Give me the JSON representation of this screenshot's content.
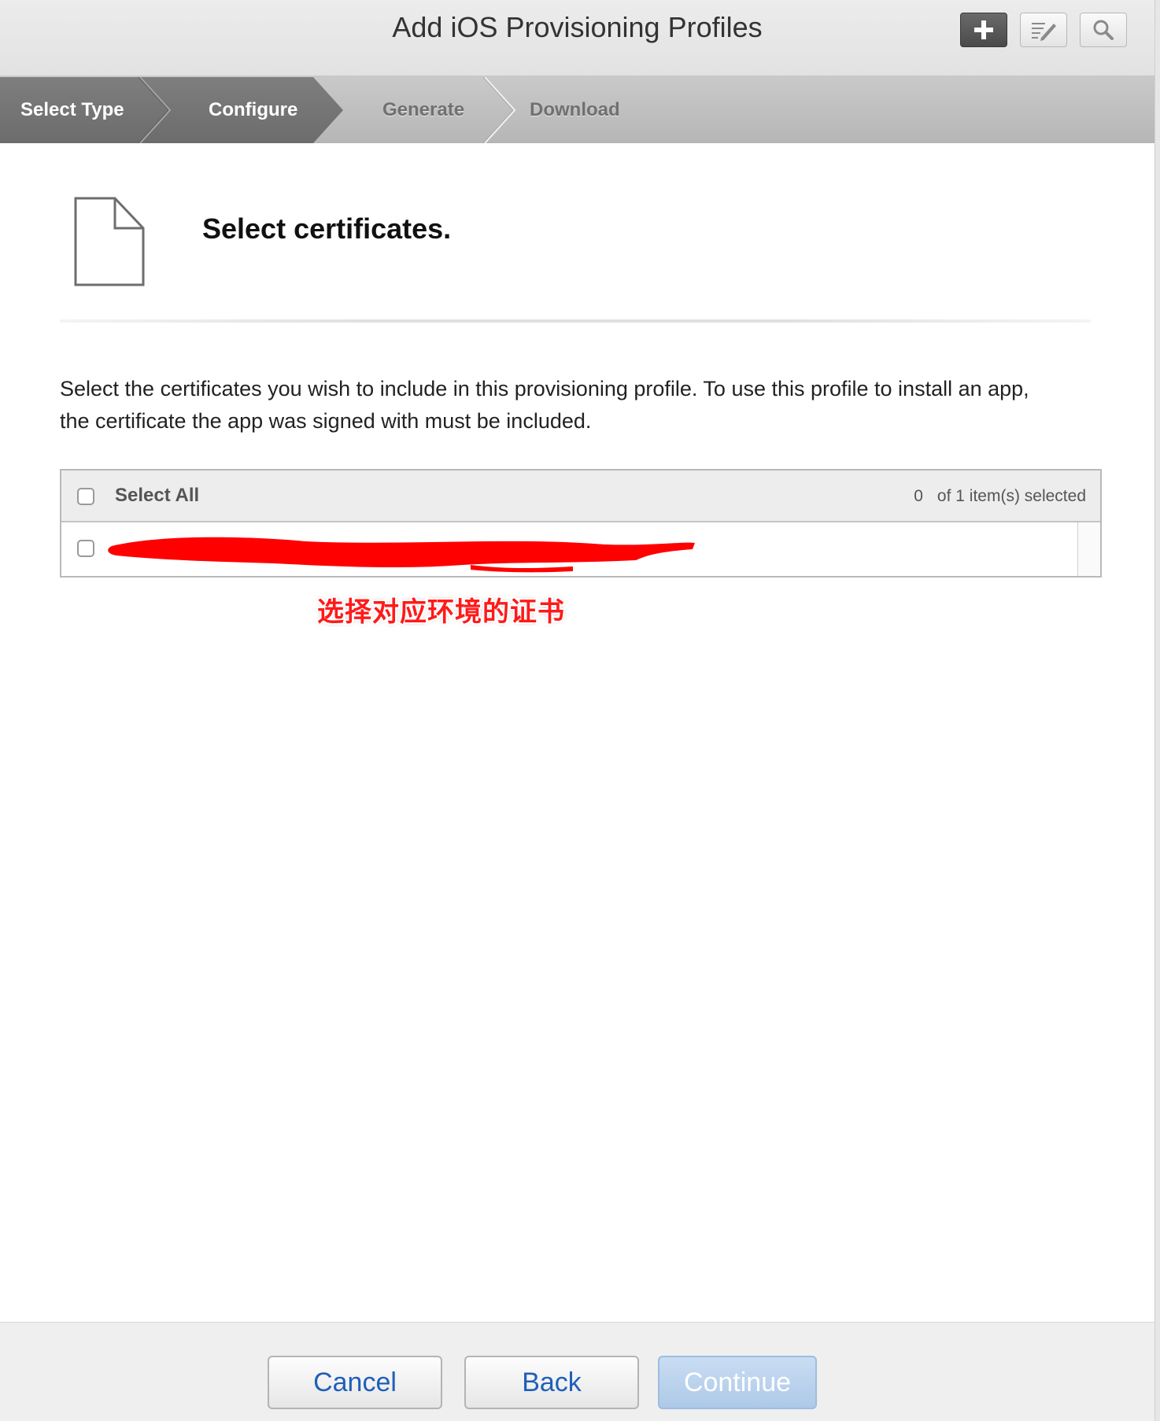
{
  "header": {
    "title": "Add iOS Provisioning Profiles",
    "tools": [
      {
        "icon": "plus-icon"
      },
      {
        "icon": "edit-list-icon"
      },
      {
        "icon": "search-icon"
      }
    ]
  },
  "steps": [
    {
      "label": "Select Type",
      "state": "completed"
    },
    {
      "label": "Configure",
      "state": "current"
    },
    {
      "label": "Generate",
      "state": "upcoming"
    },
    {
      "label": "Download",
      "state": "upcoming"
    }
  ],
  "section": {
    "icon": "document-icon",
    "title": "Select certificates."
  },
  "description": {
    "line1": "Select the certificates you wish to include in this provisioning profile. To use this profile to install an app,",
    "line2": "the certificate the app was signed with must be included."
  },
  "certificates": {
    "select_all_label": "Select All",
    "selected_count": "0",
    "total_text": "of 1 item(s) selected",
    "rows": [
      {
        "checked": false,
        "name_redacted": true
      }
    ]
  },
  "annotation": {
    "text": "选择对应环境的证书",
    "color": "#ff1a1a"
  },
  "footer": {
    "cancel_label": "Cancel",
    "back_label": "Back",
    "continue_label": "Continue",
    "continue_enabled": false
  },
  "colors": {
    "active_step": "#777777",
    "link_blue": "#1f5fb8",
    "disabled_button": "#aec9e8"
  }
}
